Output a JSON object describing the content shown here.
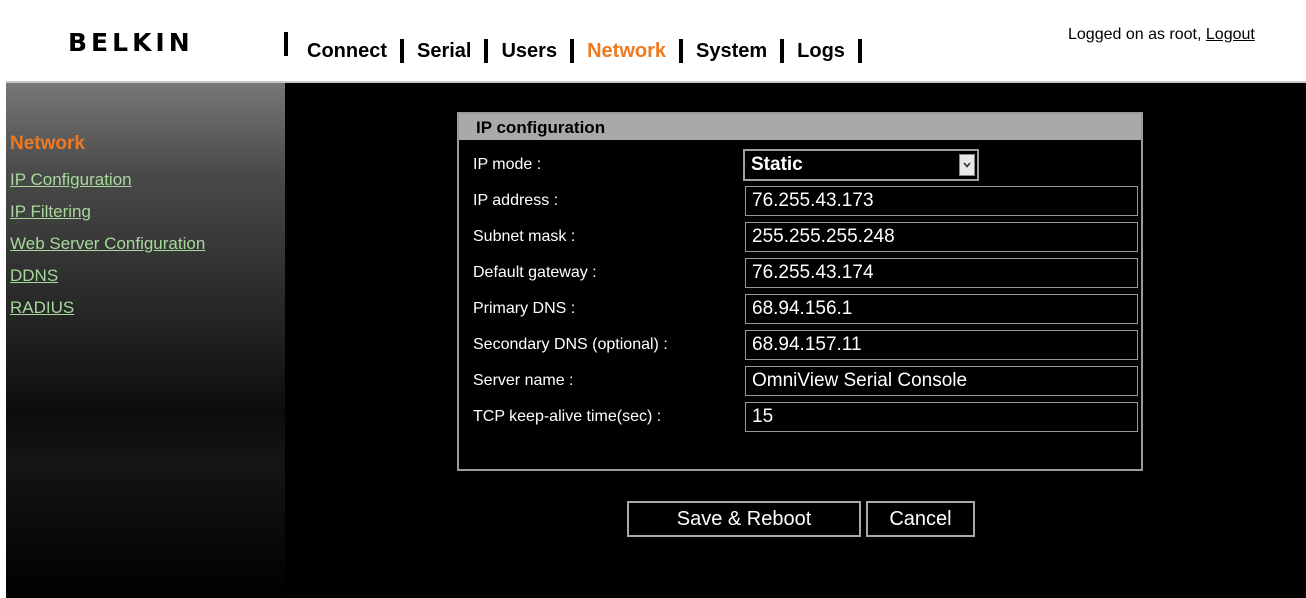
{
  "header": {
    "logo": "BELKIN",
    "nav": [
      "Connect",
      "Serial",
      "Users",
      "Network",
      "System",
      "Logs"
    ],
    "active_nav": "Network",
    "login_text": "Logged on as root,",
    "logout_label": "Logout"
  },
  "sidebar": {
    "title": "Network",
    "items": [
      {
        "label": "IP Configuration"
      },
      {
        "label": "IP Filtering"
      },
      {
        "label": "Web Server Configuration"
      },
      {
        "label": "DDNS"
      },
      {
        "label": "RADIUS"
      }
    ]
  },
  "panel": {
    "title": "IP configuration",
    "ip_mode": {
      "label": "IP mode :",
      "value": "Static"
    },
    "fields": [
      {
        "label": "IP address :",
        "value": "76.255.43.173"
      },
      {
        "label": "Subnet mask :",
        "value": "255.255.255.248"
      },
      {
        "label": "Default gateway :",
        "value": "76.255.43.174"
      },
      {
        "label": "Primary DNS :",
        "value": "68.94.156.1"
      },
      {
        "label": "Secondary DNS (optional) :",
        "value": "68.94.157.11"
      },
      {
        "label": "Server name :",
        "value": "OmniView Serial Console"
      },
      {
        "label": "TCP keep-alive time(sec) :",
        "value": "15"
      }
    ]
  },
  "buttons": {
    "save_label": "Save & Reboot",
    "cancel_label": "Cancel"
  },
  "colors": {
    "accent": "#f0791f",
    "link": "#a6d99c",
    "background": "#000000"
  },
  "icons": {
    "select_arrow": "chevron-down-icon"
  }
}
